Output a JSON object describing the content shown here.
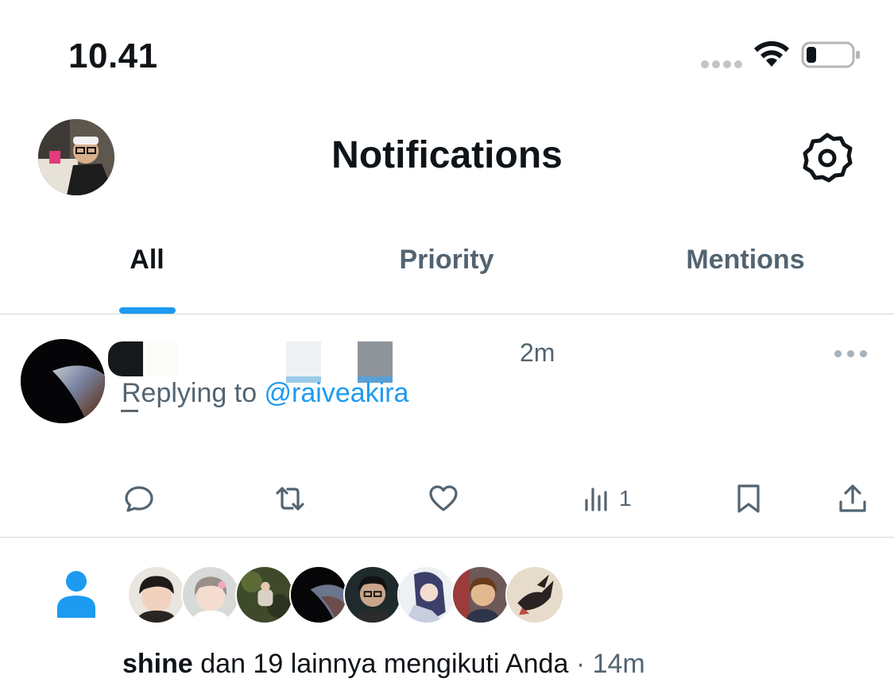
{
  "status_bar": {
    "time": "10.41",
    "icons": [
      "signal-dots-icon",
      "wifi-icon",
      "battery-icon"
    ]
  },
  "header": {
    "title": "Notifications",
    "avatar": "profile-avatar",
    "settings_icon": "gear-icon"
  },
  "tabs": [
    {
      "label": "All",
      "active": true
    },
    {
      "label": "Priority",
      "active": false
    },
    {
      "label": "Mentions",
      "active": false
    }
  ],
  "tweet": {
    "time": "2m",
    "reply_prefix": "Replying to ",
    "reply_handle": "@raiveakira",
    "actions": {
      "reply_icon": "reply-icon",
      "retweet_icon": "retweet-icon",
      "like_icon": "heart-icon",
      "views_icon": "views-icon",
      "views_count": "1",
      "bookmark_icon": "bookmark-icon",
      "share_icon": "share-icon"
    }
  },
  "follow_notification": {
    "icon": "person-icon",
    "name": "shine",
    "text": " dan 19 lainnya mengikuti Anda",
    "separator": " · ",
    "time": "14m",
    "follower_count_shown": 8
  },
  "colors": {
    "accent": "#1d9bf0",
    "text_primary": "#0f1419",
    "text_secondary": "#536471",
    "divider": "#cfd9de"
  }
}
